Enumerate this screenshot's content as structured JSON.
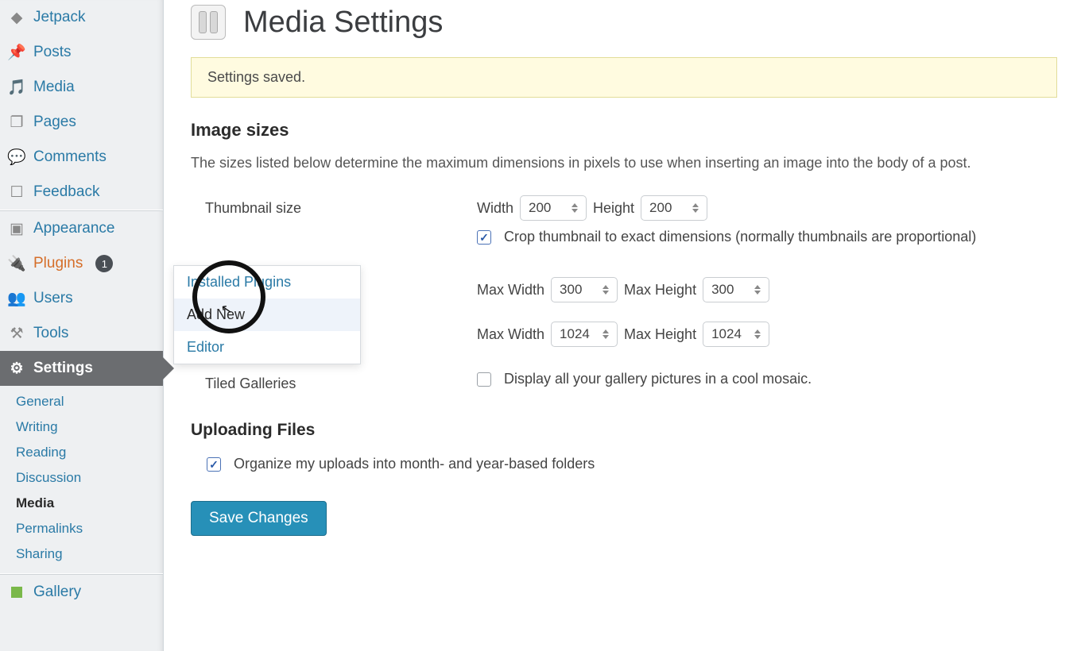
{
  "sidebar": {
    "items": [
      {
        "label": "Jetpack",
        "icon": "jetpack"
      },
      {
        "label": "Posts",
        "icon": "pin"
      },
      {
        "label": "Media",
        "icon": "media"
      },
      {
        "label": "Pages",
        "icon": "pages"
      },
      {
        "label": "Comments",
        "icon": "comments"
      },
      {
        "label": "Feedback",
        "icon": "feedback"
      },
      {
        "label": "Appearance",
        "icon": "appearance"
      },
      {
        "label": "Plugins",
        "icon": "plugins",
        "badge": "1"
      },
      {
        "label": "Users",
        "icon": "users"
      },
      {
        "label": "Tools",
        "icon": "tools"
      },
      {
        "label": "Settings",
        "icon": "settings"
      }
    ],
    "settings_sub": [
      {
        "label": "General"
      },
      {
        "label": "Writing"
      },
      {
        "label": "Reading"
      },
      {
        "label": "Discussion"
      },
      {
        "label": "Media",
        "current": true
      },
      {
        "label": "Permalinks"
      },
      {
        "label": "Sharing"
      }
    ],
    "gallery": {
      "label": "Gallery"
    }
  },
  "plugins_flyout": {
    "items": [
      {
        "label": "Installed Plugins"
      },
      {
        "label": "Add New",
        "hover": true
      },
      {
        "label": "Editor"
      }
    ]
  },
  "page": {
    "title": "Media Settings",
    "notice": "Settings saved.",
    "image_sizes_heading": "Image sizes",
    "image_sizes_desc": "The sizes listed below determine the maximum dimensions in pixels to use when inserting an image into the body of a post.",
    "thumbnail": {
      "label": "Thumbnail size",
      "width_label": "Width",
      "width_value": "200",
      "height_label": "Height",
      "height_value": "200",
      "crop_checked": true,
      "crop_label": "Crop thumbnail to exact dimensions (normally thumbnails are proportional)"
    },
    "medium": {
      "maxw_label": "Max Width",
      "maxw_value": "300",
      "maxh_label": "Max Height",
      "maxh_value": "300"
    },
    "large": {
      "maxw_label": "Max Width",
      "maxw_value": "1024",
      "maxh_label": "Max Height",
      "maxh_value": "1024"
    },
    "tiled": {
      "label": "Tiled Galleries",
      "check_label": "Display all your gallery pictures in a cool mosaic.",
      "checked": false
    },
    "uploads_heading": "Uploading Files",
    "organize": {
      "checked": true,
      "label": "Organize my uploads into month- and year-based folders"
    },
    "save_button": "Save Changes"
  }
}
